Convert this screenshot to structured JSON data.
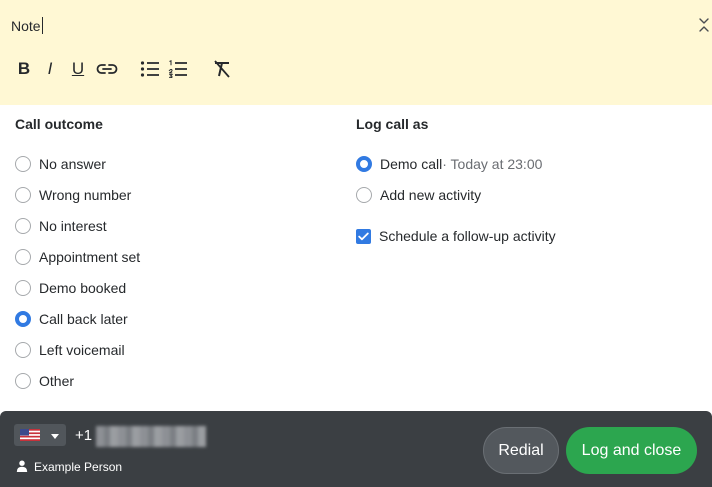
{
  "note": {
    "text": "Note",
    "toolbar": {
      "bold_glyph": "B",
      "italic_glyph": "I",
      "underline_glyph": "U"
    }
  },
  "call_outcome": {
    "title": "Call outcome",
    "selected": "Call back later",
    "options": [
      "No answer",
      "Wrong number",
      "No interest",
      "Appointment set",
      "Demo booked",
      "Call back later",
      "Left voicemail",
      "Other"
    ]
  },
  "log_call_as": {
    "title": "Log call as",
    "options": [
      {
        "label": "Demo call",
        "sublabel": " · Today at 23:00",
        "selected": true
      },
      {
        "label": "Add new activity",
        "sublabel": "",
        "selected": false
      }
    ],
    "follow_up": {
      "label": "Schedule a follow-up activity",
      "checked": true
    }
  },
  "footer": {
    "dial_code": "+1",
    "person_name": "Example Person",
    "redial_label": "Redial",
    "log_close_label": "Log and close"
  },
  "colors": {
    "note_bg": "#fff8d4",
    "accent": "#317ae2",
    "footer_bg": "#3b3f43",
    "primary_button": "#2ca64f"
  }
}
